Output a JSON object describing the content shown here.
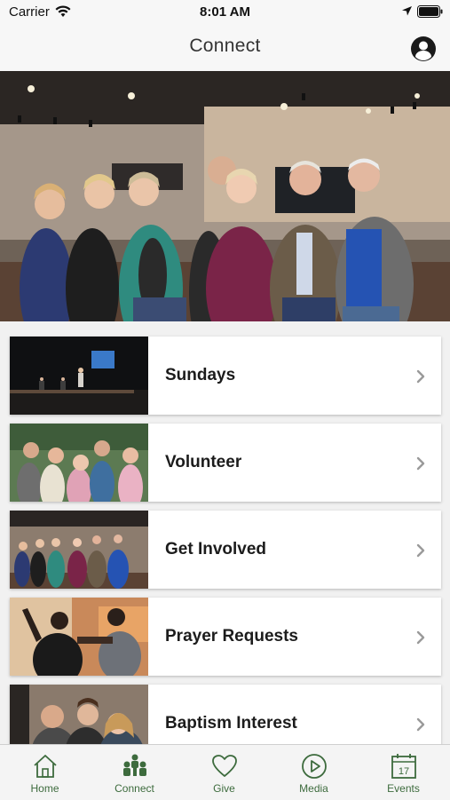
{
  "status_bar": {
    "carrier": "Carrier",
    "time": "8:01 AM"
  },
  "nav": {
    "title": "Connect"
  },
  "list": {
    "items": [
      {
        "label": "Sundays"
      },
      {
        "label": "Volunteer"
      },
      {
        "label": "Get Involved"
      },
      {
        "label": "Prayer Requests"
      },
      {
        "label": "Baptism Interest"
      }
    ]
  },
  "tabs": [
    {
      "label": "Home",
      "icon": "home-icon"
    },
    {
      "label": "Connect",
      "icon": "people-icon"
    },
    {
      "label": "Give",
      "icon": "heart-icon"
    },
    {
      "label": "Media",
      "icon": "play-icon"
    },
    {
      "label": "Events",
      "icon": "calendar-icon"
    }
  ],
  "calendar_day": "17",
  "colors": {
    "accent_green": "#3d6b3d",
    "background": "#ffffff",
    "list_background": "#f1f1f1"
  }
}
